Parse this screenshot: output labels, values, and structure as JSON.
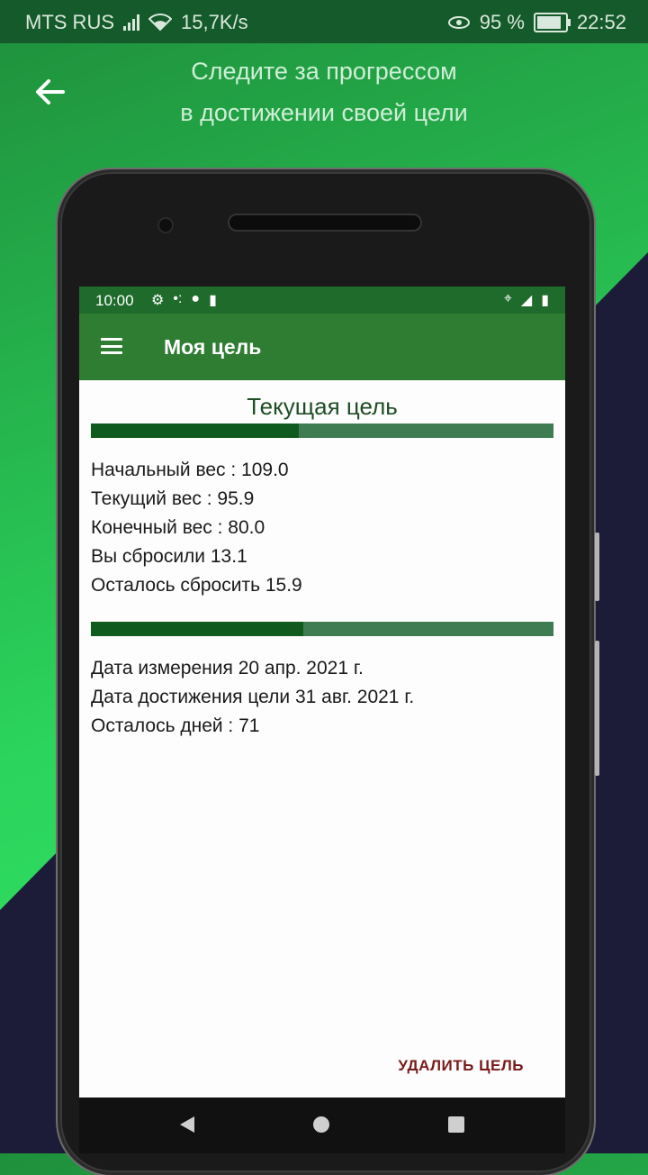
{
  "status_bar": {
    "carrier": "MTS RUS",
    "network_speed": "15,7K/s",
    "battery_percent": "95 %",
    "time": "22:52"
  },
  "header": {
    "headline_line1": "Следите за прогрессом",
    "headline_line2": "в достижении своей цели"
  },
  "device_screen": {
    "status": {
      "time": "10:00"
    },
    "toolbar": {
      "title": "Моя цель"
    },
    "goal": {
      "title": "Текущая цель",
      "weight_progress_fraction": 0.45,
      "start_weight": "Начальный вес : 109.0",
      "current_weight": "Текущий вес : 95.9",
      "target_weight": "Конечный вес : 80.0",
      "lost": "Вы сбросили 13.1",
      "remaining": "Осталось сбросить 15.9",
      "date_progress_fraction": 0.46,
      "measure_date": "Дата измерения 20 апр. 2021 г.",
      "goal_date": "Дата достижения цели 31 авг. 2021 г.",
      "days_left": "Осталось дней : 71"
    },
    "delete_button": "УДАЛИТЬ ЦЕЛЬ"
  }
}
